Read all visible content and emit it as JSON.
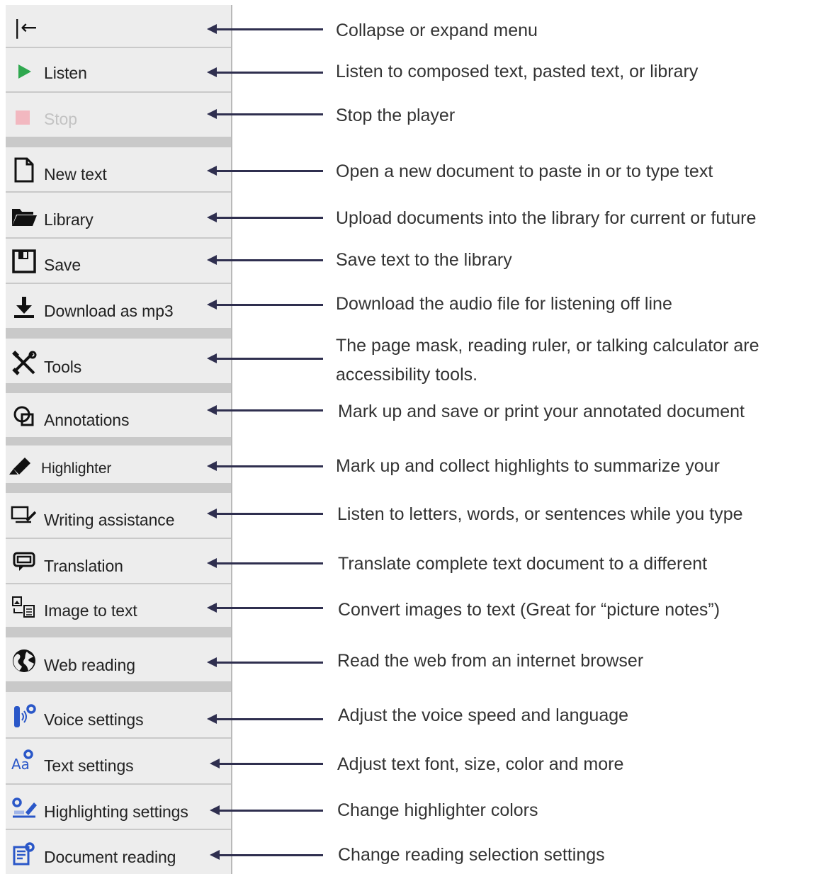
{
  "menu": {
    "collapse_glyph": "|←",
    "items": [
      {
        "id": "collapse",
        "label": "",
        "icon": "collapse-icon"
      },
      {
        "id": "listen",
        "label": "Listen",
        "icon": "play-icon"
      },
      {
        "id": "stop",
        "label": "Stop",
        "icon": "stop-icon"
      },
      {
        "id": "new-text",
        "label": "New text",
        "icon": "document-icon"
      },
      {
        "id": "library",
        "label": "Library",
        "icon": "folder-icon"
      },
      {
        "id": "save",
        "label": "Save",
        "icon": "floppy-icon"
      },
      {
        "id": "download-mp3",
        "label": "Download as mp3",
        "icon": "download-icon"
      },
      {
        "id": "tools",
        "label": "Tools",
        "icon": "tools-icon"
      },
      {
        "id": "annotations",
        "label": "Annotations",
        "icon": "annotations-icon"
      },
      {
        "id": "highlighter",
        "label": "Highlighter",
        "icon": "highlighter-icon"
      },
      {
        "id": "writing-assistance",
        "label": "Writing assistance",
        "icon": "writing-assistance-icon"
      },
      {
        "id": "translation",
        "label": "Translation",
        "icon": "translation-icon"
      },
      {
        "id": "image-to-text",
        "label": "Image to text",
        "icon": "image-to-text-icon"
      },
      {
        "id": "web-reading",
        "label": "Web reading",
        "icon": "globe-icon"
      },
      {
        "id": "voice-settings",
        "label": "Voice settings",
        "icon": "voice-settings-icon"
      },
      {
        "id": "text-settings",
        "label": "Text settings",
        "icon": "text-settings-icon"
      },
      {
        "id": "highlighting-settings",
        "label": "Highlighting settings",
        "icon": "highlighting-settings-icon"
      },
      {
        "id": "document-reading",
        "label": "Document reading",
        "icon": "document-reading-icon"
      }
    ]
  },
  "icons": {
    "text_settings_glyph": "Aa"
  },
  "colors": {
    "play": "#2fa84f",
    "stop": "#f2b8c0",
    "voice_blue": "#2a57c8",
    "arrow": "#2f2f4f"
  },
  "descriptions": [
    "Collapse or expand menu",
    "Listen to composed text, pasted text, or library",
    "Stop the player",
    "Open a new document to paste in or to type text",
    "Upload documents into the library for current or future",
    "Save text to the library",
    "Download the audio file for listening off line",
    "The page mask, reading ruler, or talking calculator are accessibility tools.",
    "Mark up and save or print your annotated document",
    "Mark up and collect highlights to summarize your",
    "Listen to letters, words, or sentences while you type",
    "Translate complete text document to a different",
    "Convert images to text (Great for “picture notes”)",
    "Read the web from an internet browser",
    "Adjust the voice speed and language",
    "Adjust text font, size, color and more",
    "Change highlighter colors",
    "Change reading selection settings"
  ]
}
